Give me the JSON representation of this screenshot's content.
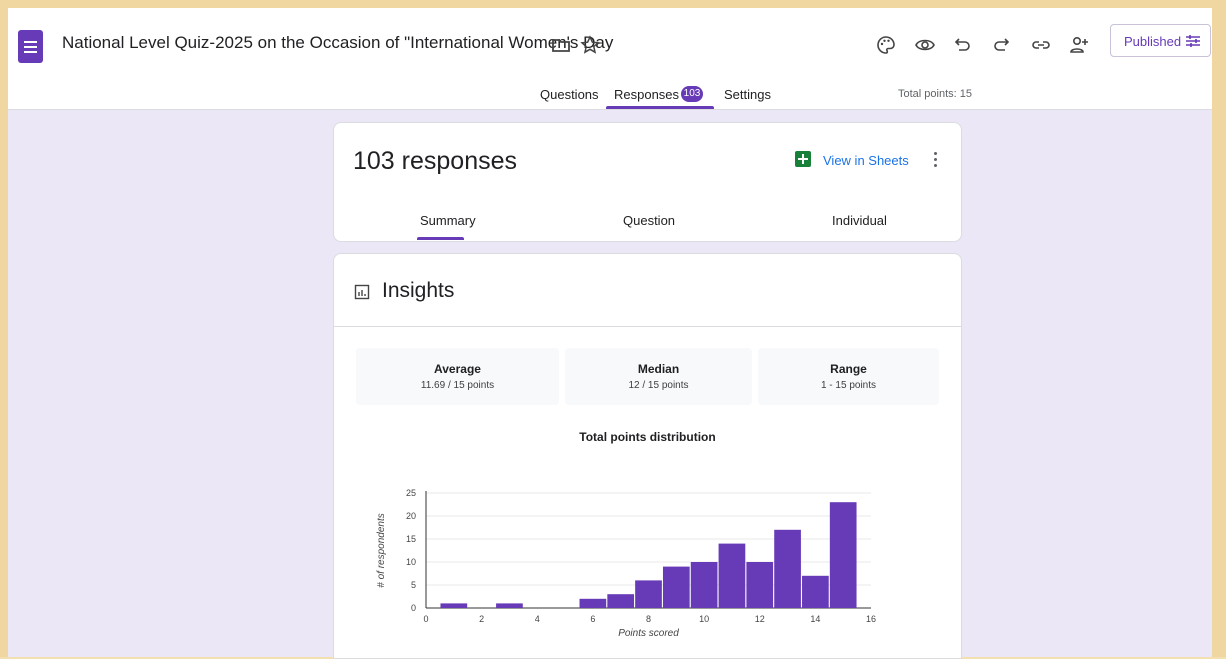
{
  "header": {
    "title": "National Level Quiz-2025 on the Occasion of \"International Women's Day",
    "publish_label": "Published"
  },
  "tabs": {
    "questions": "Questions",
    "responses": "Responses",
    "responses_count": "103",
    "settings": "Settings",
    "total_points": "Total points: 15"
  },
  "responses_card": {
    "count_label": "103 responses",
    "sheets_link": "View in Sheets",
    "subtabs": {
      "summary": "Summary",
      "question": "Question",
      "individual": "Individual"
    }
  },
  "insights": {
    "title": "Insights",
    "stats": [
      {
        "label": "Average",
        "value": "11.69 / 15 points"
      },
      {
        "label": "Median",
        "value": "12 / 15 points"
      },
      {
        "label": "Range",
        "value": "1 - 15 points"
      }
    ]
  },
  "chart_data": {
    "type": "bar",
    "title": "Total points distribution",
    "xlabel": "Points scored",
    "ylabel": "# of respondents",
    "x": [
      1,
      3,
      6,
      7,
      8,
      9,
      10,
      11,
      12,
      13,
      14,
      15
    ],
    "values": [
      1,
      1,
      2,
      3,
      6,
      9,
      10,
      14,
      10,
      17,
      7,
      23
    ],
    "xlim": [
      0,
      16
    ],
    "ylim": [
      0,
      25
    ],
    "xticks": [
      0,
      2,
      4,
      6,
      8,
      10,
      12,
      14,
      16
    ],
    "yticks": [
      0,
      5,
      10,
      15,
      20,
      25
    ],
    "grid": true,
    "bar_color": "#673ab7"
  },
  "colors": {
    "accent": "#673ab7",
    "link": "#1a73e8",
    "sheets": "#188038"
  }
}
